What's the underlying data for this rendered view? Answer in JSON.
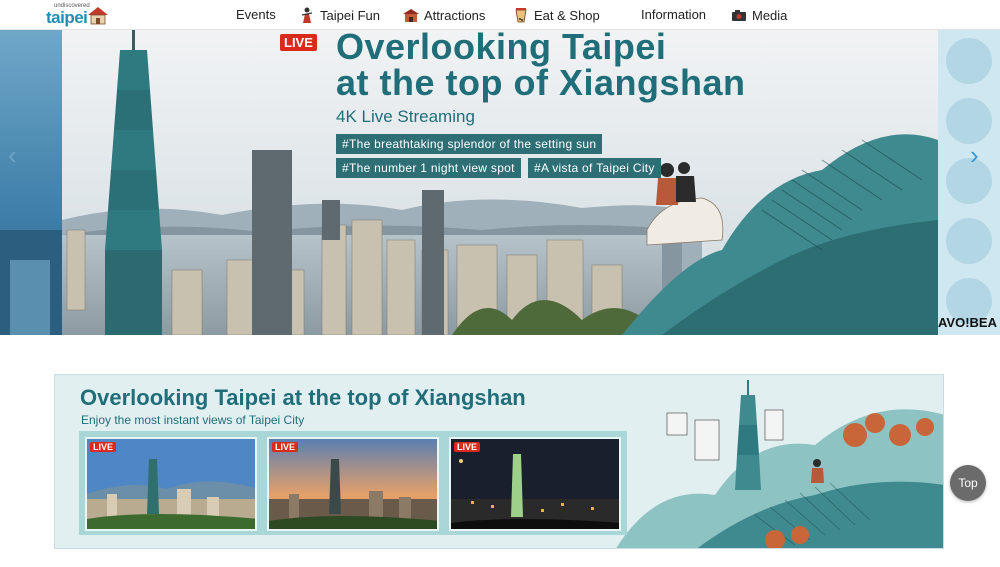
{
  "header": {
    "logo_small": "undiscovered",
    "logo_big": "taipei",
    "nav": [
      {
        "label": "Events",
        "icon": "none"
      },
      {
        "label": "Taipei Fun",
        "icon": "person-icon"
      },
      {
        "label": "Attractions",
        "icon": "building-icon"
      },
      {
        "label": "Eat & Shop",
        "icon": "drink-icon"
      },
      {
        "label": "Information",
        "icon": "none"
      },
      {
        "label": "Media",
        "icon": "camera-icon"
      }
    ]
  },
  "hero": {
    "live": "LIVE",
    "title_line1": "Overlooking Taipei",
    "title_line2": "at the top of Xiangshan",
    "subtitle": "4K Live Streaming",
    "tags": [
      "#The breathtaking splendor of the setting sun",
      "#The number 1 night view spot",
      "#A vista of Taipei City"
    ],
    "right_peek_text": "AVO!BEA",
    "arrow_left": "‹",
    "arrow_right": "›"
  },
  "banner": {
    "title": "Overlooking Taipei at the top of Xiangshan",
    "subtitle": "Enjoy the most instant views of Taipei City",
    "thumbnails": [
      {
        "live": "LIVE",
        "scene": "day"
      },
      {
        "live": "LIVE",
        "scene": "sunset"
      },
      {
        "live": "LIVE",
        "scene": "night"
      }
    ]
  },
  "top_button": "Top",
  "colors": {
    "accent_teal": "#1f6e7a",
    "tag_bg": "#2e6f76",
    "live_red": "#d92a1c"
  }
}
